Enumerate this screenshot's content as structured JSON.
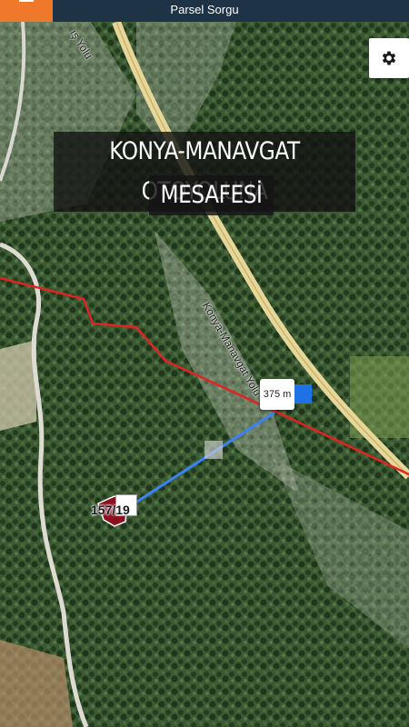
{
  "header": {
    "title": "Parsel Sorgu"
  },
  "icons": {
    "menu": "hamburger-menu-icon",
    "settings": "gear-icon"
  },
  "map": {
    "banner_line1": "KONYA-MANAVGAT OTOYOLUNA",
    "banner_line2": "MESAFESİ",
    "road_label_main": "Konya-Manavgat Yolu",
    "road_label_top": "ış Yolu",
    "distance_label": "375 m",
    "parcel_label": "157/19"
  },
  "colors": {
    "header_bg": "#1f3347",
    "menu_button": "#f0782a",
    "boundary_line": "#e02424",
    "distance_line": "#3b82f6",
    "road": "#e8d79a"
  }
}
